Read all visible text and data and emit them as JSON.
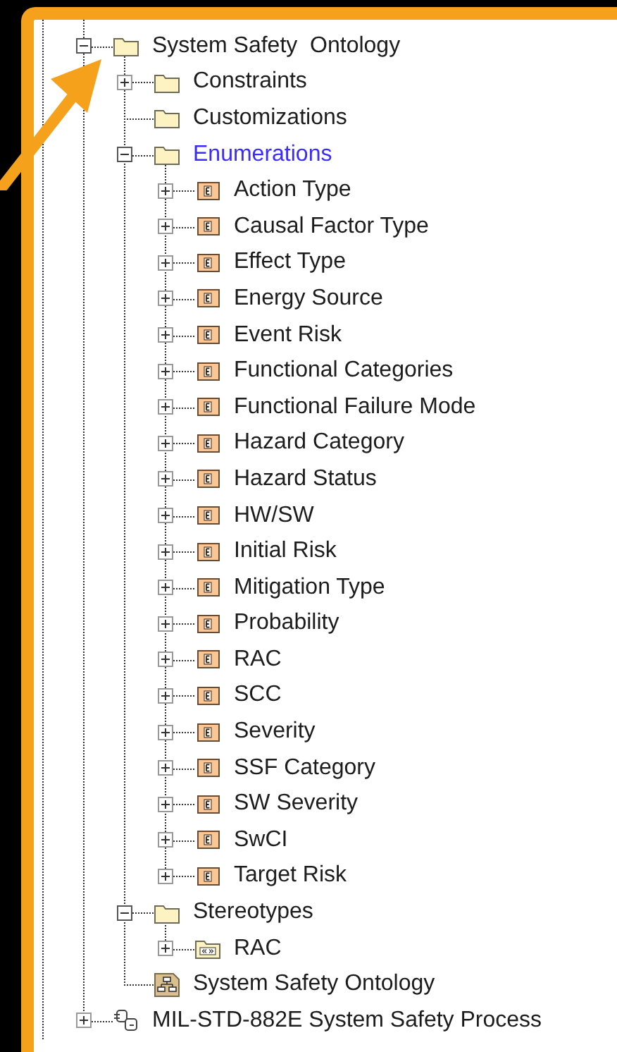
{
  "tree": [
    {
      "label": "System Safety  Ontology",
      "kind": "folder",
      "expanded": true,
      "highlighted": false,
      "children": [
        {
          "label": "Constraints",
          "kind": "folder",
          "expanded": false,
          "highlighted": false
        },
        {
          "label": "Customizations",
          "kind": "folder",
          "highlighted": false
        },
        {
          "label": "Enumerations",
          "kind": "folder",
          "expanded": true,
          "highlighted": true,
          "children": [
            {
              "label": "Action Type",
              "kind": "enumeration",
              "expanded": false,
              "highlighted": false
            },
            {
              "label": "Causal Factor Type",
              "kind": "enumeration",
              "expanded": false,
              "highlighted": false
            },
            {
              "label": "Effect Type",
              "kind": "enumeration",
              "expanded": false,
              "highlighted": false
            },
            {
              "label": "Energy Source",
              "kind": "enumeration",
              "expanded": false,
              "highlighted": false
            },
            {
              "label": "Event Risk",
              "kind": "enumeration",
              "expanded": false,
              "highlighted": false
            },
            {
              "label": "Functional Categories",
              "kind": "enumeration",
              "expanded": false,
              "highlighted": false
            },
            {
              "label": "Functional Failure Mode",
              "kind": "enumeration",
              "expanded": false,
              "highlighted": false
            },
            {
              "label": "Hazard Category",
              "kind": "enumeration",
              "expanded": false,
              "highlighted": false
            },
            {
              "label": "Hazard Status",
              "kind": "enumeration",
              "expanded": false,
              "highlighted": false
            },
            {
              "label": "HW/SW",
              "kind": "enumeration",
              "expanded": false,
              "highlighted": false
            },
            {
              "label": "Initial Risk",
              "kind": "enumeration",
              "expanded": false,
              "highlighted": false
            },
            {
              "label": "Mitigation Type",
              "kind": "enumeration",
              "expanded": false,
              "highlighted": false
            },
            {
              "label": "Probability",
              "kind": "enumeration",
              "expanded": false,
              "highlighted": false
            },
            {
              "label": "RAC",
              "kind": "enumeration",
              "expanded": false,
              "highlighted": false
            },
            {
              "label": "SCC",
              "kind": "enumeration",
              "expanded": false,
              "highlighted": false
            },
            {
              "label": "Severity",
              "kind": "enumeration",
              "expanded": false,
              "highlighted": false
            },
            {
              "label": "SSF Category",
              "kind": "enumeration",
              "expanded": false,
              "highlighted": false
            },
            {
              "label": "SW Severity",
              "kind": "enumeration",
              "expanded": false,
              "highlighted": false
            },
            {
              "label": "SwCI",
              "kind": "enumeration",
              "expanded": false,
              "highlighted": false
            },
            {
              "label": "Target Risk",
              "kind": "enumeration",
              "expanded": false,
              "highlighted": false
            }
          ]
        },
        {
          "label": "Stereotypes",
          "kind": "folder",
          "expanded": true,
          "highlighted": false,
          "children": [
            {
              "label": "RAC",
              "kind": "stereotype",
              "expanded": false,
              "highlighted": false
            }
          ]
        },
        {
          "label": "System Safety Ontology",
          "kind": "diagram",
          "highlighted": false
        }
      ]
    },
    {
      "label": "MIL-STD-882E System Safety Process",
      "kind": "model",
      "expanded": false,
      "highlighted": false
    }
  ]
}
